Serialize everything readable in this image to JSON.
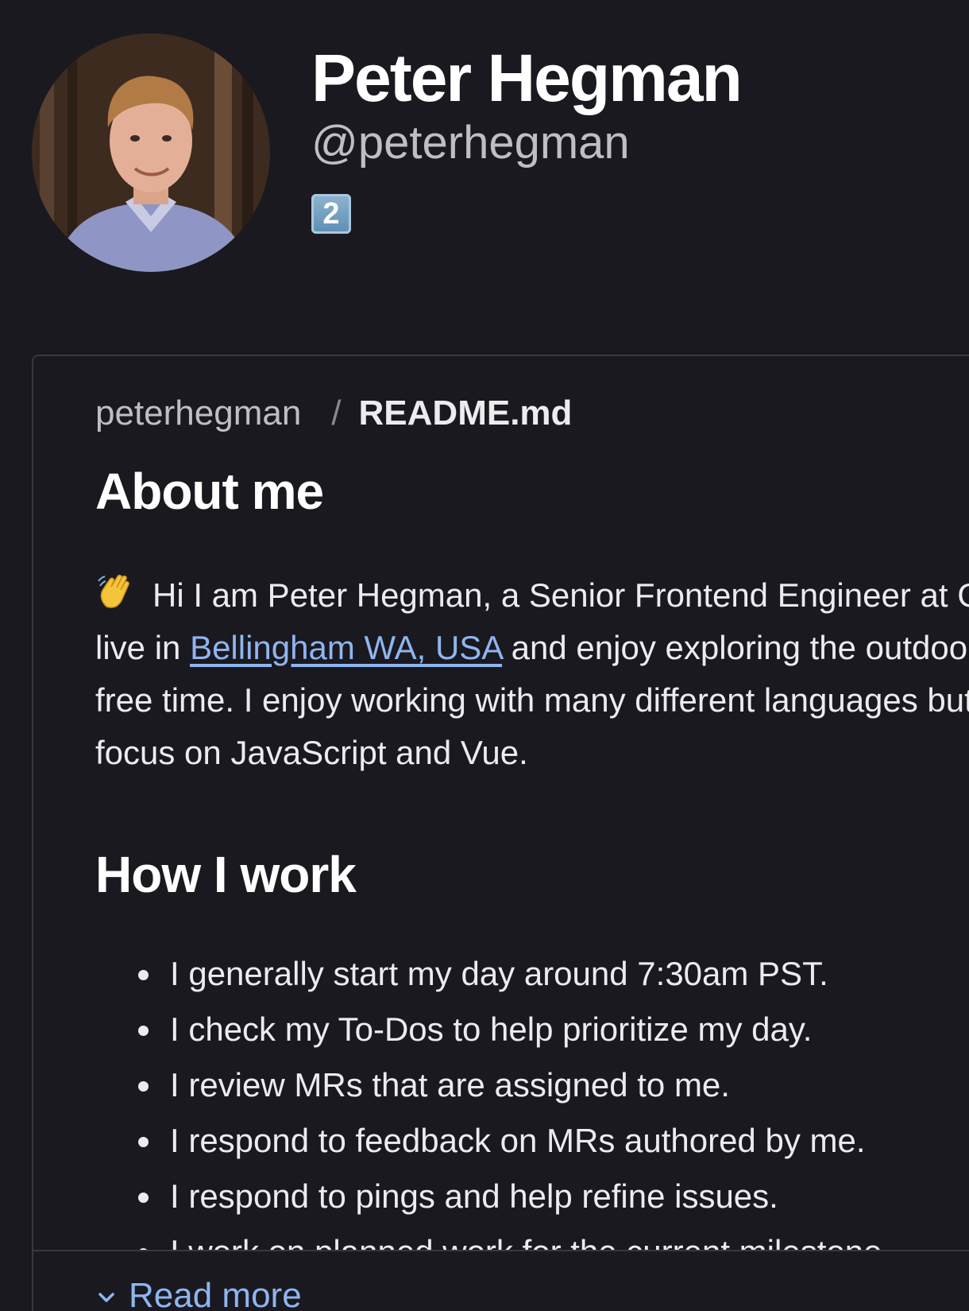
{
  "profile": {
    "name": "Peter Hegman",
    "username": "@peterhegman",
    "badge": "2"
  },
  "readme": {
    "breadcrumb": {
      "user": "peterhegman",
      "separator": "/",
      "file": "README.md"
    },
    "about": {
      "heading": "About me",
      "intro": "Hi I am Peter Hegman, a Senior Frontend Engineer at GitLab. I live in ",
      "location_link": "Bellingham WA, USA",
      "outro": " and enjoy exploring the outdoors in my free time. I enjoy working with many different languages but mainly focus on JavaScript and Vue."
    },
    "how_i_work": {
      "heading": "How I work",
      "items": [
        "I generally start my day around 7:30am PST.",
        "I check my To-Dos to help prioritize my day.",
        "I review MRs that are assigned to me.",
        "I respond to feedback on MRs authored by me.",
        "I respond to pings and help refine issues.",
        "I work on planned work for the current milestone."
      ]
    },
    "read_more": "Read more"
  },
  "colors": {
    "background": "#1a1920",
    "link": "#8fb5ee",
    "border": "#3a383f"
  },
  "icons": {
    "wave": "waving-hand-icon",
    "chevron": "chevron-down-icon"
  }
}
